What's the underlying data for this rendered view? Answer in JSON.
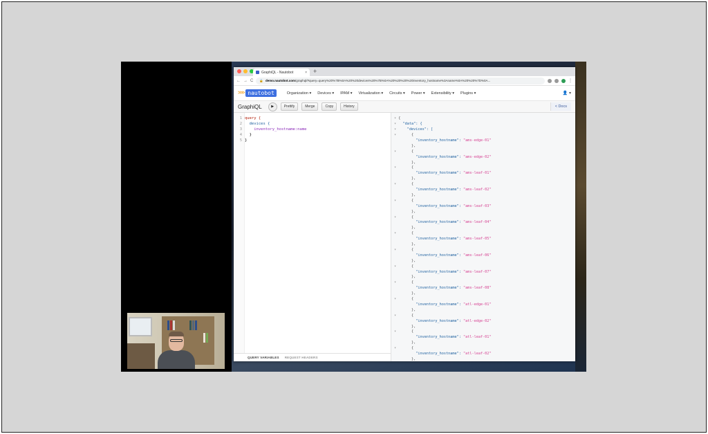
{
  "browser": {
    "tab_title": "GraphiQL - Nautobot",
    "tab_close": "×",
    "new_tab": "+",
    "nav_back": "←",
    "nav_forward": "→",
    "nav_reload": "C",
    "url_domain": "demo.nautobot.com",
    "url_path": "/graphql/#query=query%20%7B%0A%20%20devices%20%7B%0A%20%20%20%20inventory_hostname%3Aname%0A%20%20%7D%0A..."
  },
  "app": {
    "logo_text": "nautobot",
    "logo_arrows": ">>>",
    "menu": [
      "Organization ▾",
      "Devices ▾",
      "IPAM ▾",
      "Virtualization ▾",
      "Circuits ▾",
      "Power ▾",
      "Extensibility ▾",
      "Plugins ▾"
    ],
    "user_menu": "👤 ▾"
  },
  "graphiql": {
    "title": "GraphiQL",
    "run_symbol": "▶",
    "buttons": {
      "prettify": "Prettify",
      "merge": "Merge",
      "copy": "Copy",
      "history": "History"
    },
    "docs": "< Docs",
    "query_lines": [
      {
        "n": "1",
        "text": "query {"
      },
      {
        "n": "2",
        "text": "  devices {"
      },
      {
        "n": "3",
        "text": "    inventory_hostname:name"
      },
      {
        "n": "4",
        "text": "  }"
      },
      {
        "n": "5",
        "text": "}"
      }
    ],
    "variables_tab": "QUERY VARIABLES",
    "headers_tab": "REQUEST HEADERS",
    "result": {
      "open": "{",
      "data_key": "\"data\": {",
      "devices_key": "\"devices\": [",
      "field_key": "\"inventory_hostname\":",
      "hostnames": [
        "\"ams-edge-01\"",
        "\"ams-edge-02\"",
        "\"ams-leaf-01\"",
        "\"ams-leaf-02\"",
        "\"ams-leaf-03\"",
        "\"ams-leaf-04\"",
        "\"ams-leaf-05\"",
        "\"ams-leaf-06\"",
        "\"ams-leaf-07\"",
        "\"ams-leaf-08\"",
        "\"atl-edge-01\"",
        "\"atl-edge-02\"",
        "\"atl-leaf-01\"",
        "\"atl-leaf-02\""
      ]
    }
  },
  "colors": {
    "traffic_red": "#ff5f57",
    "traffic_yellow": "#febc2e",
    "traffic_green": "#28c840",
    "brand_blue": "#3d6fe0"
  }
}
